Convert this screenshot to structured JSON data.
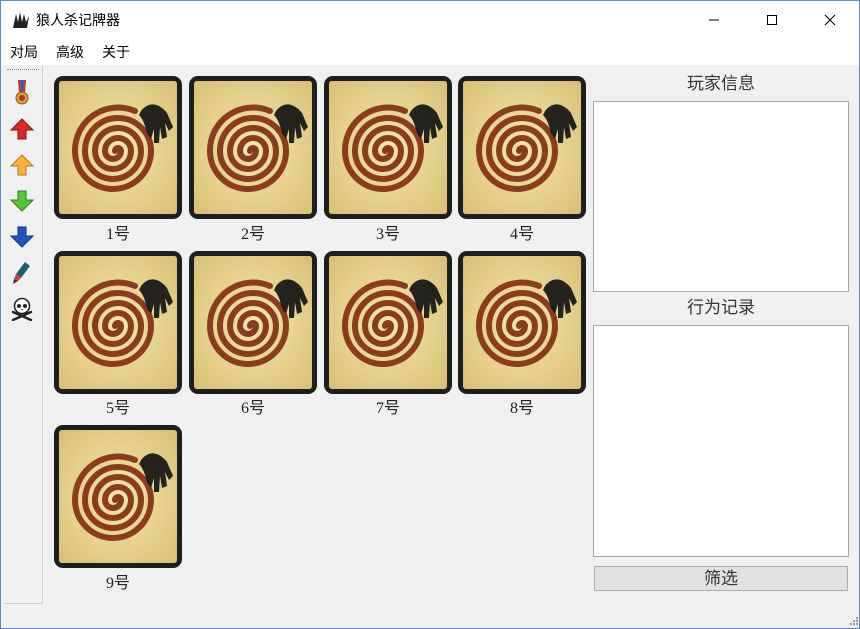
{
  "window": {
    "title": "狼人杀记牌器"
  },
  "menu": [
    "对局",
    "高级",
    "关于"
  ],
  "toolbar": {
    "tools": [
      {
        "name": "sheriff-badge-icon"
      },
      {
        "name": "arrow-up-red-icon"
      },
      {
        "name": "arrow-up-orange-icon"
      },
      {
        "name": "arrow-down-green-icon"
      },
      {
        "name": "arrow-down-blue-icon"
      },
      {
        "name": "pen-icon"
      },
      {
        "name": "skull-crossbones-icon"
      }
    ]
  },
  "players": [
    {
      "label": "1号"
    },
    {
      "label": "2号"
    },
    {
      "label": "3号"
    },
    {
      "label": "4号"
    },
    {
      "label": "5号"
    },
    {
      "label": "6号"
    },
    {
      "label": "7号"
    },
    {
      "label": "8号"
    },
    {
      "label": "9号"
    }
  ],
  "player_info": {
    "title": "玩家信息",
    "content": ""
  },
  "action_log": {
    "title": "行为记录",
    "content": ""
  },
  "filter_button": {
    "label": "筛选"
  },
  "colors": {
    "card_border": "#1e1e1e",
    "card_parchment": "#ead89a",
    "spiral": "#8a3c1e",
    "window_border": "#5a8fc4"
  }
}
